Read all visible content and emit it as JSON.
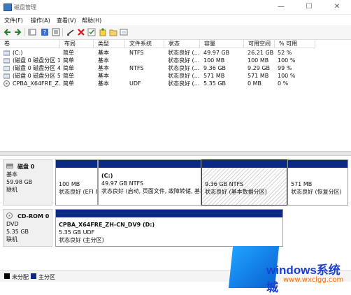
{
  "window": {
    "title": "磁盘管理",
    "minimize": "—",
    "maximize": "☐",
    "close": "✕"
  },
  "menu": {
    "items": [
      "文件(F)",
      "操作(A)",
      "查看(V)",
      "帮助(H)"
    ]
  },
  "toolbar": {
    "icons": [
      "back-arrow-icon",
      "forward-arrow-icon",
      "console-tree-icon",
      "help-icon",
      "properties-icon",
      "connect-icon",
      "delete-icon",
      "check-icon",
      "new-volume-icon",
      "open-icon"
    ]
  },
  "volumes": {
    "headers": [
      "卷",
      "布局",
      "类型",
      "文件系统",
      "状态",
      "容量",
      "可用空间",
      "% 可用"
    ],
    "rows": [
      [
        "(C:)",
        "简单",
        "基本",
        "NTFS",
        "状态良好 (…",
        "49.97 GB",
        "26.21 GB",
        "52 %"
      ],
      [
        "(磁盘 0 磁盘分区 1)",
        "简单",
        "基本",
        "",
        "状态良好 (…",
        "100 MB",
        "100 MB",
        "100 %"
      ],
      [
        "(磁盘 0 磁盘分区 4)",
        "简单",
        "基本",
        "NTFS",
        "状态良好 (…",
        "9.36 GB",
        "9.29 GB",
        "99 %"
      ],
      [
        "(磁盘 0 磁盘分区 5)",
        "简单",
        "基本",
        "",
        "状态良好 (…",
        "571 MB",
        "571 MB",
        "100 %"
      ],
      [
        "CPBA_X64FRE_Z…",
        "简单",
        "基本",
        "UDF",
        "状态良好 (…",
        "5.35 GB",
        "0 MB",
        "0 %"
      ]
    ]
  },
  "disk0": {
    "name": "磁盘 0",
    "type": "基本",
    "size": "59.98 GB",
    "status": "联机",
    "partitions": [
      {
        "title": "",
        "size": "100 MB",
        "status": "状态良好 (EFI 系统分区)"
      },
      {
        "title": "(C:)",
        "size": "49.97 GB NTFS",
        "status": "状态良好 (启动, 页面文件, 故障转储, 基本数据分区)"
      },
      {
        "title": "",
        "size": "9.36 GB NTFS",
        "status": "状态良好 (基本数据分区)"
      },
      {
        "title": "",
        "size": "571 MB",
        "status": "状态良好 (恢复分区)"
      }
    ]
  },
  "cdrom0": {
    "name": "CD-ROM 0",
    "type": "DVD",
    "size": "5.35 GB",
    "status": "联机",
    "volume": {
      "title": "CPBA_X64FRE_ZH-CN_DV9  (D:)",
      "size": "5.35 GB UDF",
      "status": "状态良好 (主分区)"
    }
  },
  "legend": {
    "unallocated": "未分配",
    "primary": "主分区",
    "colors": {
      "unallocated": "#000000",
      "primary": "#0b2a86"
    }
  },
  "watermark": {
    "text": "windows系统城",
    "url": "www.wxclgg.com"
  }
}
